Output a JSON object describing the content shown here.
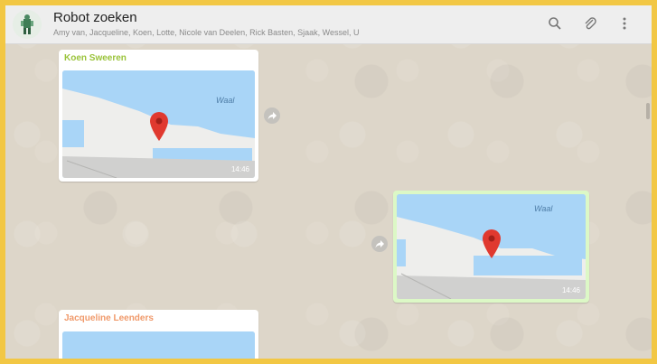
{
  "header": {
    "title": "Robot zoeken",
    "participants": "Amy van, Jacqueline, Koen, Lotte, Nicole van Deelen, Rick Basten, Sjaak, Wessel, U",
    "icons": [
      "search-icon",
      "attach-icon",
      "more-vert-icon"
    ]
  },
  "messages": [
    {
      "sender": "Koen Sweeren",
      "sender_color": "#9ac33a",
      "map_label": "Waal",
      "time": "14:46"
    },
    {
      "sender": "",
      "map_label": "Waal",
      "time": "14:46"
    },
    {
      "sender": "Jacqueline Leenders",
      "sender_color": "#f0996a"
    }
  ],
  "colors": {
    "frame": "#f2c744",
    "chat_bg": "#ddd6c9",
    "map_water": "#a9d5f7",
    "pin": "#e0392f"
  }
}
